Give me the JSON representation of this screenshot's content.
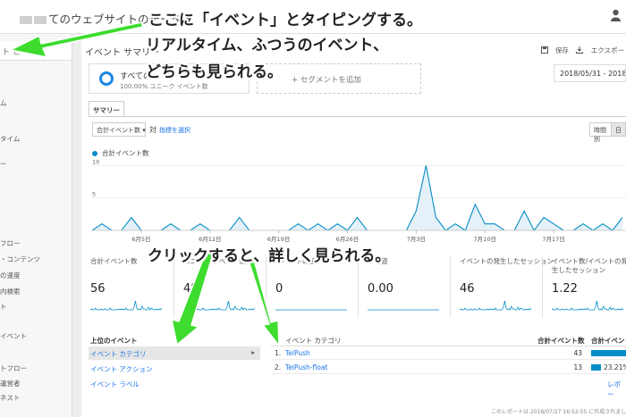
{
  "topbar": {
    "title": "てのウェブサイトのデータ ▾"
  },
  "sidebar": {
    "search_text": "ト と",
    "items": [
      "ム",
      "タイム",
      "ー",
      "フロー",
      "・コンテンツ",
      "の速度",
      "内検索",
      "ト",
      "イベント",
      "トフロー",
      "運営者",
      "ネスト"
    ]
  },
  "header": {
    "title": "イベント サマリー",
    "save": "保存",
    "export": "エクスポー",
    "date_range": "2018/05/31 - 2018/"
  },
  "segment": {
    "name": "すべての",
    "subtitle": "100.00% ユニーク イベント数",
    "add": "+ セグメントを追加"
  },
  "tabs": {
    "summary": "サマリー"
  },
  "controls": {
    "metric": "合計イベント数 ▾",
    "vs": "対",
    "pick_metric": "指標を選択",
    "gran_hour": "時間別",
    "gran_day": "日"
  },
  "chart_data": {
    "type": "area",
    "legend": "合計イベント数",
    "y_ticks": [
      10,
      5
    ],
    "ylim": [
      0,
      11
    ],
    "x_tick_labels": [
      {
        "label": "6月5日",
        "index": 5
      },
      {
        "label": "6月12日",
        "index": 12
      },
      {
        "label": "6月19日",
        "index": 19
      },
      {
        "label": "6月26日",
        "index": 26
      },
      {
        "label": "7月3日",
        "index": 33
      },
      {
        "label": "7月10日",
        "index": 40
      },
      {
        "label": "7月17日",
        "index": 47
      }
    ],
    "values": [
      0,
      1,
      0,
      0,
      2,
      0,
      0,
      0,
      1,
      0,
      0,
      1,
      0,
      0,
      0,
      2,
      0,
      0,
      0,
      0,
      0,
      1,
      0,
      1,
      0,
      1,
      0,
      2,
      0,
      0,
      0,
      0,
      0,
      3,
      10,
      2,
      0,
      1,
      0,
      4,
      1,
      1,
      0,
      0,
      3,
      0,
      2,
      1,
      0,
      0,
      1,
      0,
      1,
      0,
      2
    ]
  },
  "stats": [
    {
      "label": "合計イベント数",
      "value": "56"
    },
    {
      "label": "ユニーク イベント数",
      "value": "48"
    },
    {
      "label": "イベントの値",
      "value": "0"
    },
    {
      "label": "平均値",
      "value": "0.00"
    },
    {
      "label": "イベントの発生したセッション",
      "value": "46"
    },
    {
      "label": "イベント数/イベントの発生したセッション",
      "value": "1.22"
    }
  ],
  "left_panel": {
    "header": "上位のイベント",
    "items": [
      "イベント カテゴリ",
      "イベント アクション",
      "イベント ラベル"
    ]
  },
  "table": {
    "col_name": "イベント カテゴリ",
    "col_total": "合計イベント数",
    "col_pct": "合計イベント",
    "rows": [
      {
        "idx": "1.",
        "name": "TelPush",
        "count": "43",
        "pct": "",
        "share": 0.7679
      },
      {
        "idx": "2.",
        "name": "TelPush-float",
        "count": "13",
        "pct": "23.21%",
        "share": 0.2321
      }
    ],
    "report_link": "レポー"
  },
  "footnote": "このレポートは 2018/07/27 16:52:55 に作成されました",
  "annotations": {
    "line1": "ここに「イベント」とタイピングする。",
    "line2": "リアルタイム、ふつうのイベント、",
    "line3": "どちらも見られる。",
    "line4": "クリックすると、詳しく見られる。"
  },
  "colors": {
    "accent": "#058dc7",
    "link": "#1a73e8",
    "arrow": "#3ddc2f"
  }
}
